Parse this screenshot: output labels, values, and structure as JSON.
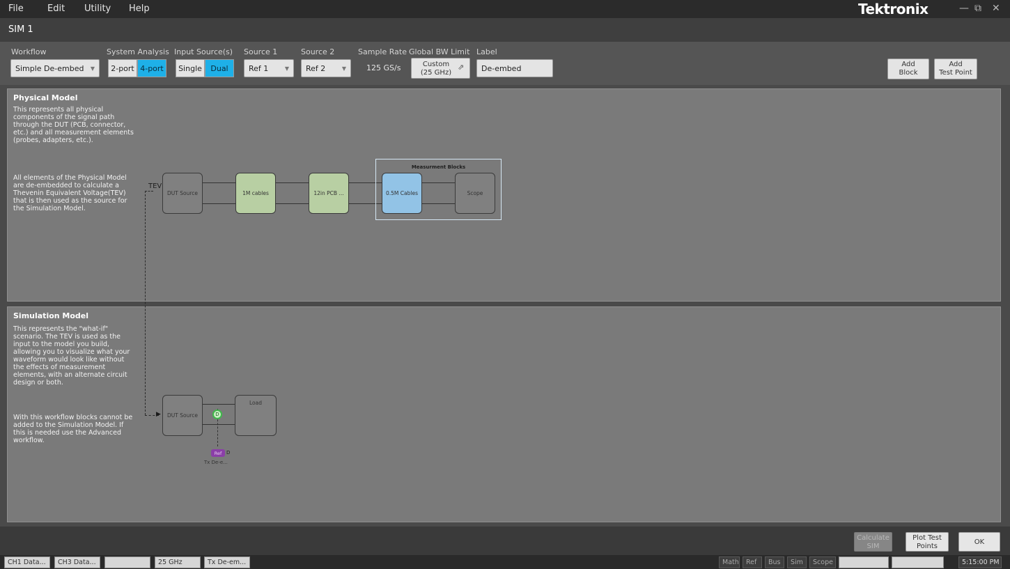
{
  "menu": {
    "file": "File",
    "edit": "Edit",
    "utility": "Utility",
    "help": "Help"
  },
  "brand": "Tektronix",
  "window_controls": {
    "minimize": "—",
    "restore": "⧉",
    "close": "✕"
  },
  "window_title": "SIM 1",
  "toolbar": {
    "workflow": {
      "label": "Workflow",
      "value": "Simple De-embed"
    },
    "system_analysis": {
      "label": "System Analysis",
      "options": [
        "2-port",
        "4-port"
      ],
      "selected": "4-port"
    },
    "input_sources": {
      "label": "Input Source(s)",
      "options": [
        "Single",
        "Dual"
      ],
      "selected": "Dual"
    },
    "source1": {
      "label": "Source 1",
      "value": "Ref 1"
    },
    "source2": {
      "label": "Source 2",
      "value": "Ref 2"
    },
    "sample_rate": {
      "label": "Sample Rate",
      "value": "125 GS/s"
    },
    "bw_limit": {
      "label": "Global BW Limit",
      "line1": "Custom",
      "line2": "(25 GHz)"
    },
    "label": {
      "label": "Label",
      "value": "De-embed"
    },
    "add_block": {
      "line1": "Add",
      "line2": "Block"
    },
    "add_test_point": {
      "line1": "Add",
      "line2": "Test Point"
    }
  },
  "physical_model": {
    "title": "Physical Model",
    "desc1": "This represents all physical components of the signal path through the DUT (PCB, connector, etc.) and all measurement elements (probes, adapters, etc.).",
    "desc2": "All elements of the Physical Model are de-embedded to calculate a Thevenin Equivalent Voltage(TEV) that is then used as the source for the Simulation Model.",
    "tev_label": "TEV",
    "blocks": {
      "dut": "DUT Source",
      "cables": "1M cables",
      "pcb": "12in PCB ...",
      "meas_cables": "0.5M Cables",
      "scope": "Scope"
    },
    "measurement_group": "Measurment Blocks"
  },
  "simulation_model": {
    "title": "Simulation Model",
    "desc1": "This represents the \"what-if\" scenario. The TEV is used as the input to the model you build, allowing you to visualize what your waveform would look like without the effects of measurement elements, with an alternate circuit design or both.",
    "desc2": "With this workflow blocks cannot be added to the Simulation Model. If this is needed use the Advanced workflow.",
    "blocks": {
      "dut": "DUT Source",
      "load": "Load"
    },
    "test_point": {
      "node": "D",
      "badge": "Ref",
      "badge_suffix": "D",
      "caption": "Tx De-e..."
    }
  },
  "actions": {
    "calculate": {
      "line1": "Calculate",
      "line2": "SIM"
    },
    "plot": {
      "line1": "Plot Test",
      "line2": "Points"
    },
    "ok": "OK"
  },
  "status": {
    "chips": [
      "CH1 Data...",
      "CH3 Data...",
      "",
      "25 GHz",
      "Tx De-em..."
    ],
    "tabs": [
      "Math",
      "Ref",
      "Bus",
      "Sim",
      "Scope"
    ],
    "time": "5:15:00 PM"
  },
  "colors": {
    "accent_blue": "#1eb0e8",
    "block_green": "#b8cfa3",
    "block_blue": "#92c3e6",
    "test_point_green": "#3fb84a",
    "ref_badge_purple": "#8b3fa8"
  }
}
